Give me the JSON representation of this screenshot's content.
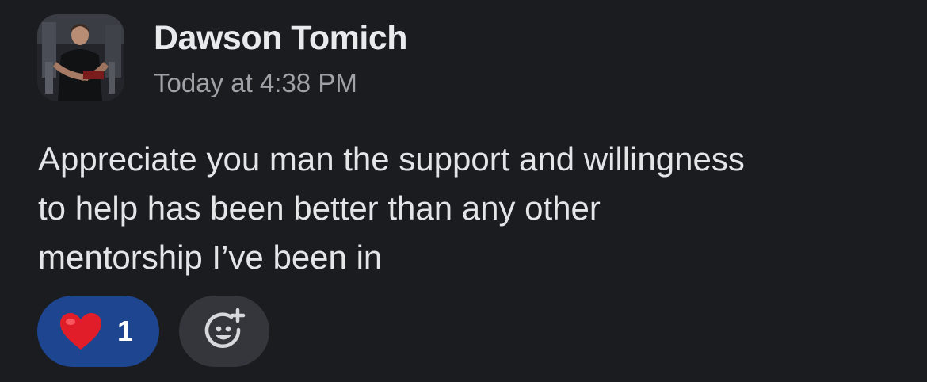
{
  "message": {
    "author": "Dawson Tomich",
    "timestamp": "Today at 4:38 PM",
    "body_lines": [
      "Appreciate you man the support and willingness",
      "to help has been better than any other",
      "mentorship I’ve been in"
    ]
  },
  "reactions": [
    {
      "icon": "heart-emoji-icon",
      "count": "1",
      "active": true
    }
  ],
  "add_reaction": {
    "icon": "add-emoji-icon"
  },
  "colors": {
    "background": "#1b1c20",
    "reaction_active": "#1d4590",
    "add_reaction_bg": "#35363b",
    "timestamp": "#a0a2a8"
  }
}
